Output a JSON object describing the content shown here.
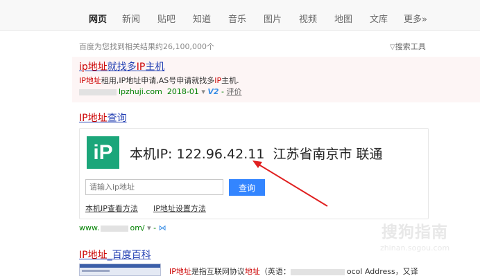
{
  "tabs": [
    "网页",
    "新闻",
    "贴吧",
    "知道",
    "音乐",
    "图片",
    "视频",
    "地图",
    "文库",
    "更多»"
  ],
  "result_stats": "百度为您找到相关结果约26,100,000个",
  "search_tools": "搜索工具",
  "ad": {
    "title_red": "ip地址",
    "title_rest": "就找多",
    "title_red2": "IP",
    "title_end": "主机",
    "desc_red": "IP地址",
    "desc_mid": "租用,IP地址申请,AS号申请就找多",
    "desc_red2": "IP",
    "desc_end": "主机.",
    "url_partial": "lpzhuji.com",
    "date": "2018-01",
    "v_badge": "V2",
    "eval": "评价"
  },
  "ip_card": {
    "title_red": "IP地址",
    "title_rest": "查询",
    "logo": "iP",
    "ip_label": "本机IP:",
    "ip_value": "122.96.42.11",
    "location": "江苏省南京市 联通",
    "input_placeholder": "请输入ip地址",
    "button": "查询",
    "link1": "本机IP查看方法",
    "link2": "IP地址设置方法"
  },
  "site_url": {
    "prefix": "www.",
    "suffix": "om/"
  },
  "baike": {
    "title_red": "IP地址",
    "title_rest": "_百度百科",
    "desc_red": "IP地址",
    "desc_mid": "是指互联网协议",
    "desc_red2": "地址",
    "desc_mid2": "（英语：",
    "desc_end": "ocol Address，又译"
  },
  "watermark": {
    "main": "搜狗指南",
    "sub": "zhinan.sogou.com"
  },
  "colors": {
    "link": "#2440b3",
    "highlight": "#c00000",
    "url_green": "#008000",
    "logo_green": "#1ba67a",
    "button_blue": "#3385ff",
    "arrow_red": "#e02020"
  }
}
